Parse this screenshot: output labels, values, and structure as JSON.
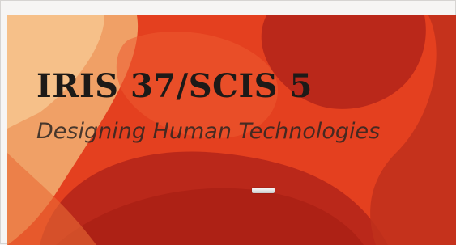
{
  "banner": {
    "title": "IRIS 37/SCIS 5",
    "subtitle": "Designing Human Technologies"
  },
  "colors": {
    "background": "#e2391e",
    "title": "#1d1a18",
    "subtitle": "#2b2522"
  },
  "slider": {
    "indicator_icon": "slide-indicator-icon"
  }
}
